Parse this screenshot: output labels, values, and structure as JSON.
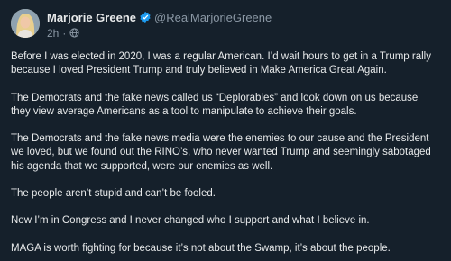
{
  "author": {
    "display_name": "Marjorie Greene",
    "handle": "@RealMarjorieGreene",
    "verified": true,
    "avatar_icon": "profile-photo"
  },
  "meta": {
    "time": "2h",
    "separator": "·",
    "audience_icon": "globe-icon"
  },
  "tweet": {
    "paragraphs": [
      "Before I was elected in 2020, I was a regular American. I’d wait hours to get in a Trump rally because I loved President Trump and truly believed in Make America Great Again.",
      "The Democrats and the fake news called us “Deplorables” and look down on us because they view average Americans as a tool to manipulate to achieve their goals.",
      "The Democrats and the fake news media were the enemies to our cause and the President we loved, but we found out the RINO’s, who never wanted Trump and seemingly sabotaged his agenda that we supported, were our enemies as well.",
      "The people aren’t stupid and can’t be fooled.",
      "Now I’m in Congress and I never changed who I support and what I believe in.",
      "MAGA is worth fighting for because it’s not about the Swamp, it’s about the people."
    ]
  },
  "colors": {
    "background": "#15202b",
    "text": "#e7e9ea",
    "muted": "#8b98a5",
    "verified_badge": "#1d9bf0"
  }
}
